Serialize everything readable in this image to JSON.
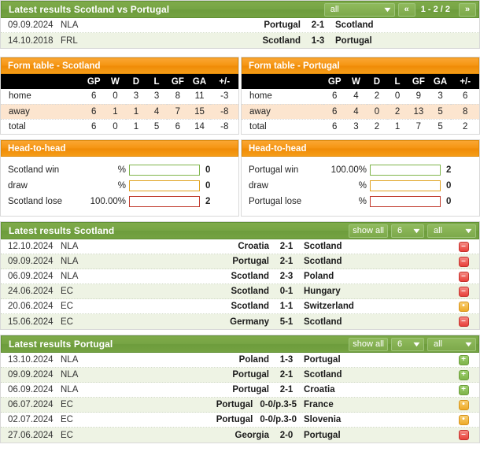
{
  "top_section": {
    "title": "Latest results Scotland vs Portugal",
    "filter_select": {
      "value": "all",
      "chevron": "chevron-down-icon"
    },
    "prev_label": "«",
    "next_label": "»",
    "page_info": "1 - 2 / 2",
    "rows": [
      {
        "date": "09.09.2024",
        "league": "NLA",
        "home": "Portugal",
        "score": "2-1",
        "away": "Scotland"
      },
      {
        "date": "14.10.2018",
        "league": "FRL",
        "home": "Scotland",
        "score": "1-3",
        "away": "Portugal"
      }
    ]
  },
  "form_tables": [
    {
      "title": "Form table - Scotland",
      "columns": [
        "",
        "GP",
        "W",
        "D",
        "L",
        "GF",
        "GA",
        "+/-"
      ],
      "rows": [
        {
          "label": "home",
          "GP": "6",
          "W": "0",
          "D": "3",
          "L": "3",
          "GF": "8",
          "GA": "11",
          "pm": "-3"
        },
        {
          "label": "away",
          "GP": "6",
          "W": "1",
          "D": "1",
          "L": "4",
          "GF": "7",
          "GA": "15",
          "pm": "-8"
        },
        {
          "label": "total",
          "GP": "6",
          "W": "0",
          "D": "1",
          "L": "5",
          "GF": "6",
          "GA": "14",
          "pm": "-8"
        }
      ]
    },
    {
      "title": "Form table - Portugal",
      "columns": [
        "",
        "GP",
        "W",
        "D",
        "L",
        "GF",
        "GA",
        "+/-"
      ],
      "rows": [
        {
          "label": "home",
          "GP": "6",
          "W": "4",
          "D": "2",
          "L": "0",
          "GF": "9",
          "GA": "3",
          "pm": "6"
        },
        {
          "label": "away",
          "GP": "6",
          "W": "4",
          "D": "0",
          "L": "2",
          "GF": "13",
          "GA": "5",
          "pm": "8"
        },
        {
          "label": "total",
          "GP": "6",
          "W": "3",
          "D": "2",
          "L": "1",
          "GF": "7",
          "GA": "5",
          "pm": "2"
        }
      ]
    }
  ],
  "head_to_head": [
    {
      "title": "Head-to-head",
      "rows": [
        {
          "label": "Scotland win",
          "pct": "%",
          "fill": 0,
          "count": "0",
          "kind": "win"
        },
        {
          "label": "draw",
          "pct": "%",
          "fill": 0,
          "count": "0",
          "kind": "draw"
        },
        {
          "label": "Scotland lose",
          "pct": "100.00%",
          "fill": 100,
          "count": "2",
          "kind": "lose"
        }
      ]
    },
    {
      "title": "Head-to-head",
      "rows": [
        {
          "label": "Portugal win",
          "pct": "100.00%",
          "fill": 100,
          "count": "2",
          "kind": "win"
        },
        {
          "label": "draw",
          "pct": "%",
          "fill": 0,
          "count": "0",
          "kind": "draw"
        },
        {
          "label": "Portugal lose",
          "pct": "%",
          "fill": 0,
          "count": "0",
          "kind": "lose"
        }
      ]
    }
  ],
  "latest_results": [
    {
      "title": "Latest results Scotland",
      "show_all_label": "show all",
      "count_select": {
        "value": "6",
        "chevron": "chevron-down-icon"
      },
      "filter_select": {
        "value": "all",
        "chevron": "chevron-down-icon"
      },
      "rows": [
        {
          "date": "12.10.2024",
          "league": "NLA",
          "home": "Croatia",
          "score": "2-1",
          "away": "Scotland",
          "result": "lose"
        },
        {
          "date": "09.09.2024",
          "league": "NLA",
          "home": "Portugal",
          "score": "2-1",
          "away": "Scotland",
          "result": "lose"
        },
        {
          "date": "06.09.2024",
          "league": "NLA",
          "home": "Scotland",
          "score": "2-3",
          "away": "Poland",
          "result": "lose"
        },
        {
          "date": "24.06.2024",
          "league": "EC",
          "home": "Scotland",
          "score": "0-1",
          "away": "Hungary",
          "result": "lose"
        },
        {
          "date": "20.06.2024",
          "league": "EC",
          "home": "Scotland",
          "score": "1-1",
          "away": "Switzerland",
          "result": "draw"
        },
        {
          "date": "15.06.2024",
          "league": "EC",
          "home": "Germany",
          "score": "5-1",
          "away": "Scotland",
          "result": "lose"
        }
      ]
    },
    {
      "title": "Latest results Portugal",
      "show_all_label": "show all",
      "count_select": {
        "value": "6",
        "chevron": "chevron-down-icon"
      },
      "filter_select": {
        "value": "all",
        "chevron": "chevron-down-icon"
      },
      "rows": [
        {
          "date": "13.10.2024",
          "league": "NLA",
          "home": "Poland",
          "score": "1-3",
          "away": "Portugal",
          "result": "win"
        },
        {
          "date": "09.09.2024",
          "league": "NLA",
          "home": "Portugal",
          "score": "2-1",
          "away": "Scotland",
          "result": "win"
        },
        {
          "date": "06.09.2024",
          "league": "NLA",
          "home": "Portugal",
          "score": "2-1",
          "away": "Croatia",
          "result": "win"
        },
        {
          "date": "06.07.2024",
          "league": "EC",
          "home": "Portugal",
          "score": "0-0/p.3-5",
          "away": "France",
          "result": "draw"
        },
        {
          "date": "02.07.2024",
          "league": "EC",
          "home": "Portugal",
          "score": "0-0/p.3-0",
          "away": "Slovenia",
          "result": "draw"
        },
        {
          "date": "27.06.2024",
          "league": "EC",
          "home": "Georgia",
          "score": "2-0",
          "away": "Portugal",
          "result": "lose"
        }
      ]
    }
  ],
  "badge_glyphs": {
    "win": "+",
    "lose": "–",
    "draw": "•"
  },
  "colors": {
    "green_header": "#74a242",
    "orange_header": "#f59410",
    "win": "#7fb24a",
    "lose": "#ee2211",
    "draw": "#eeaa28",
    "alt_row": "#eef3e4",
    "form_alt_row": "#fce5cf"
  }
}
